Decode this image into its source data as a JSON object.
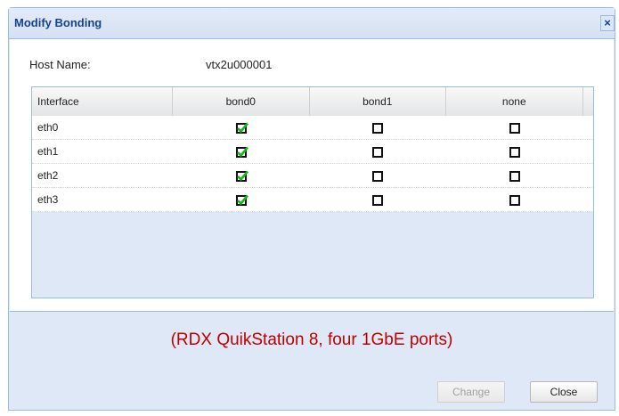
{
  "dialog": {
    "title": "Modify Bonding",
    "close_glyph": "×",
    "host_label": "Host Name:",
    "host_value": "vtx2u000001",
    "note": "(RDX QuikStation 8, four 1GbE ports)",
    "change_label": "Change",
    "close_label": "Close"
  },
  "grid": {
    "headers": [
      "Interface",
      "bond0",
      "bond1",
      "none"
    ],
    "rows": [
      {
        "iface": "eth0",
        "bond0": true,
        "bond1": false,
        "none": false
      },
      {
        "iface": "eth1",
        "bond0": true,
        "bond1": false,
        "none": false
      },
      {
        "iface": "eth2",
        "bond0": true,
        "bond1": false,
        "none": false
      },
      {
        "iface": "eth3",
        "bond0": true,
        "bond1": false,
        "none": false
      }
    ]
  },
  "colors": {
    "title": "#15428b",
    "note": "#c00000",
    "check": "#16b51a"
  }
}
